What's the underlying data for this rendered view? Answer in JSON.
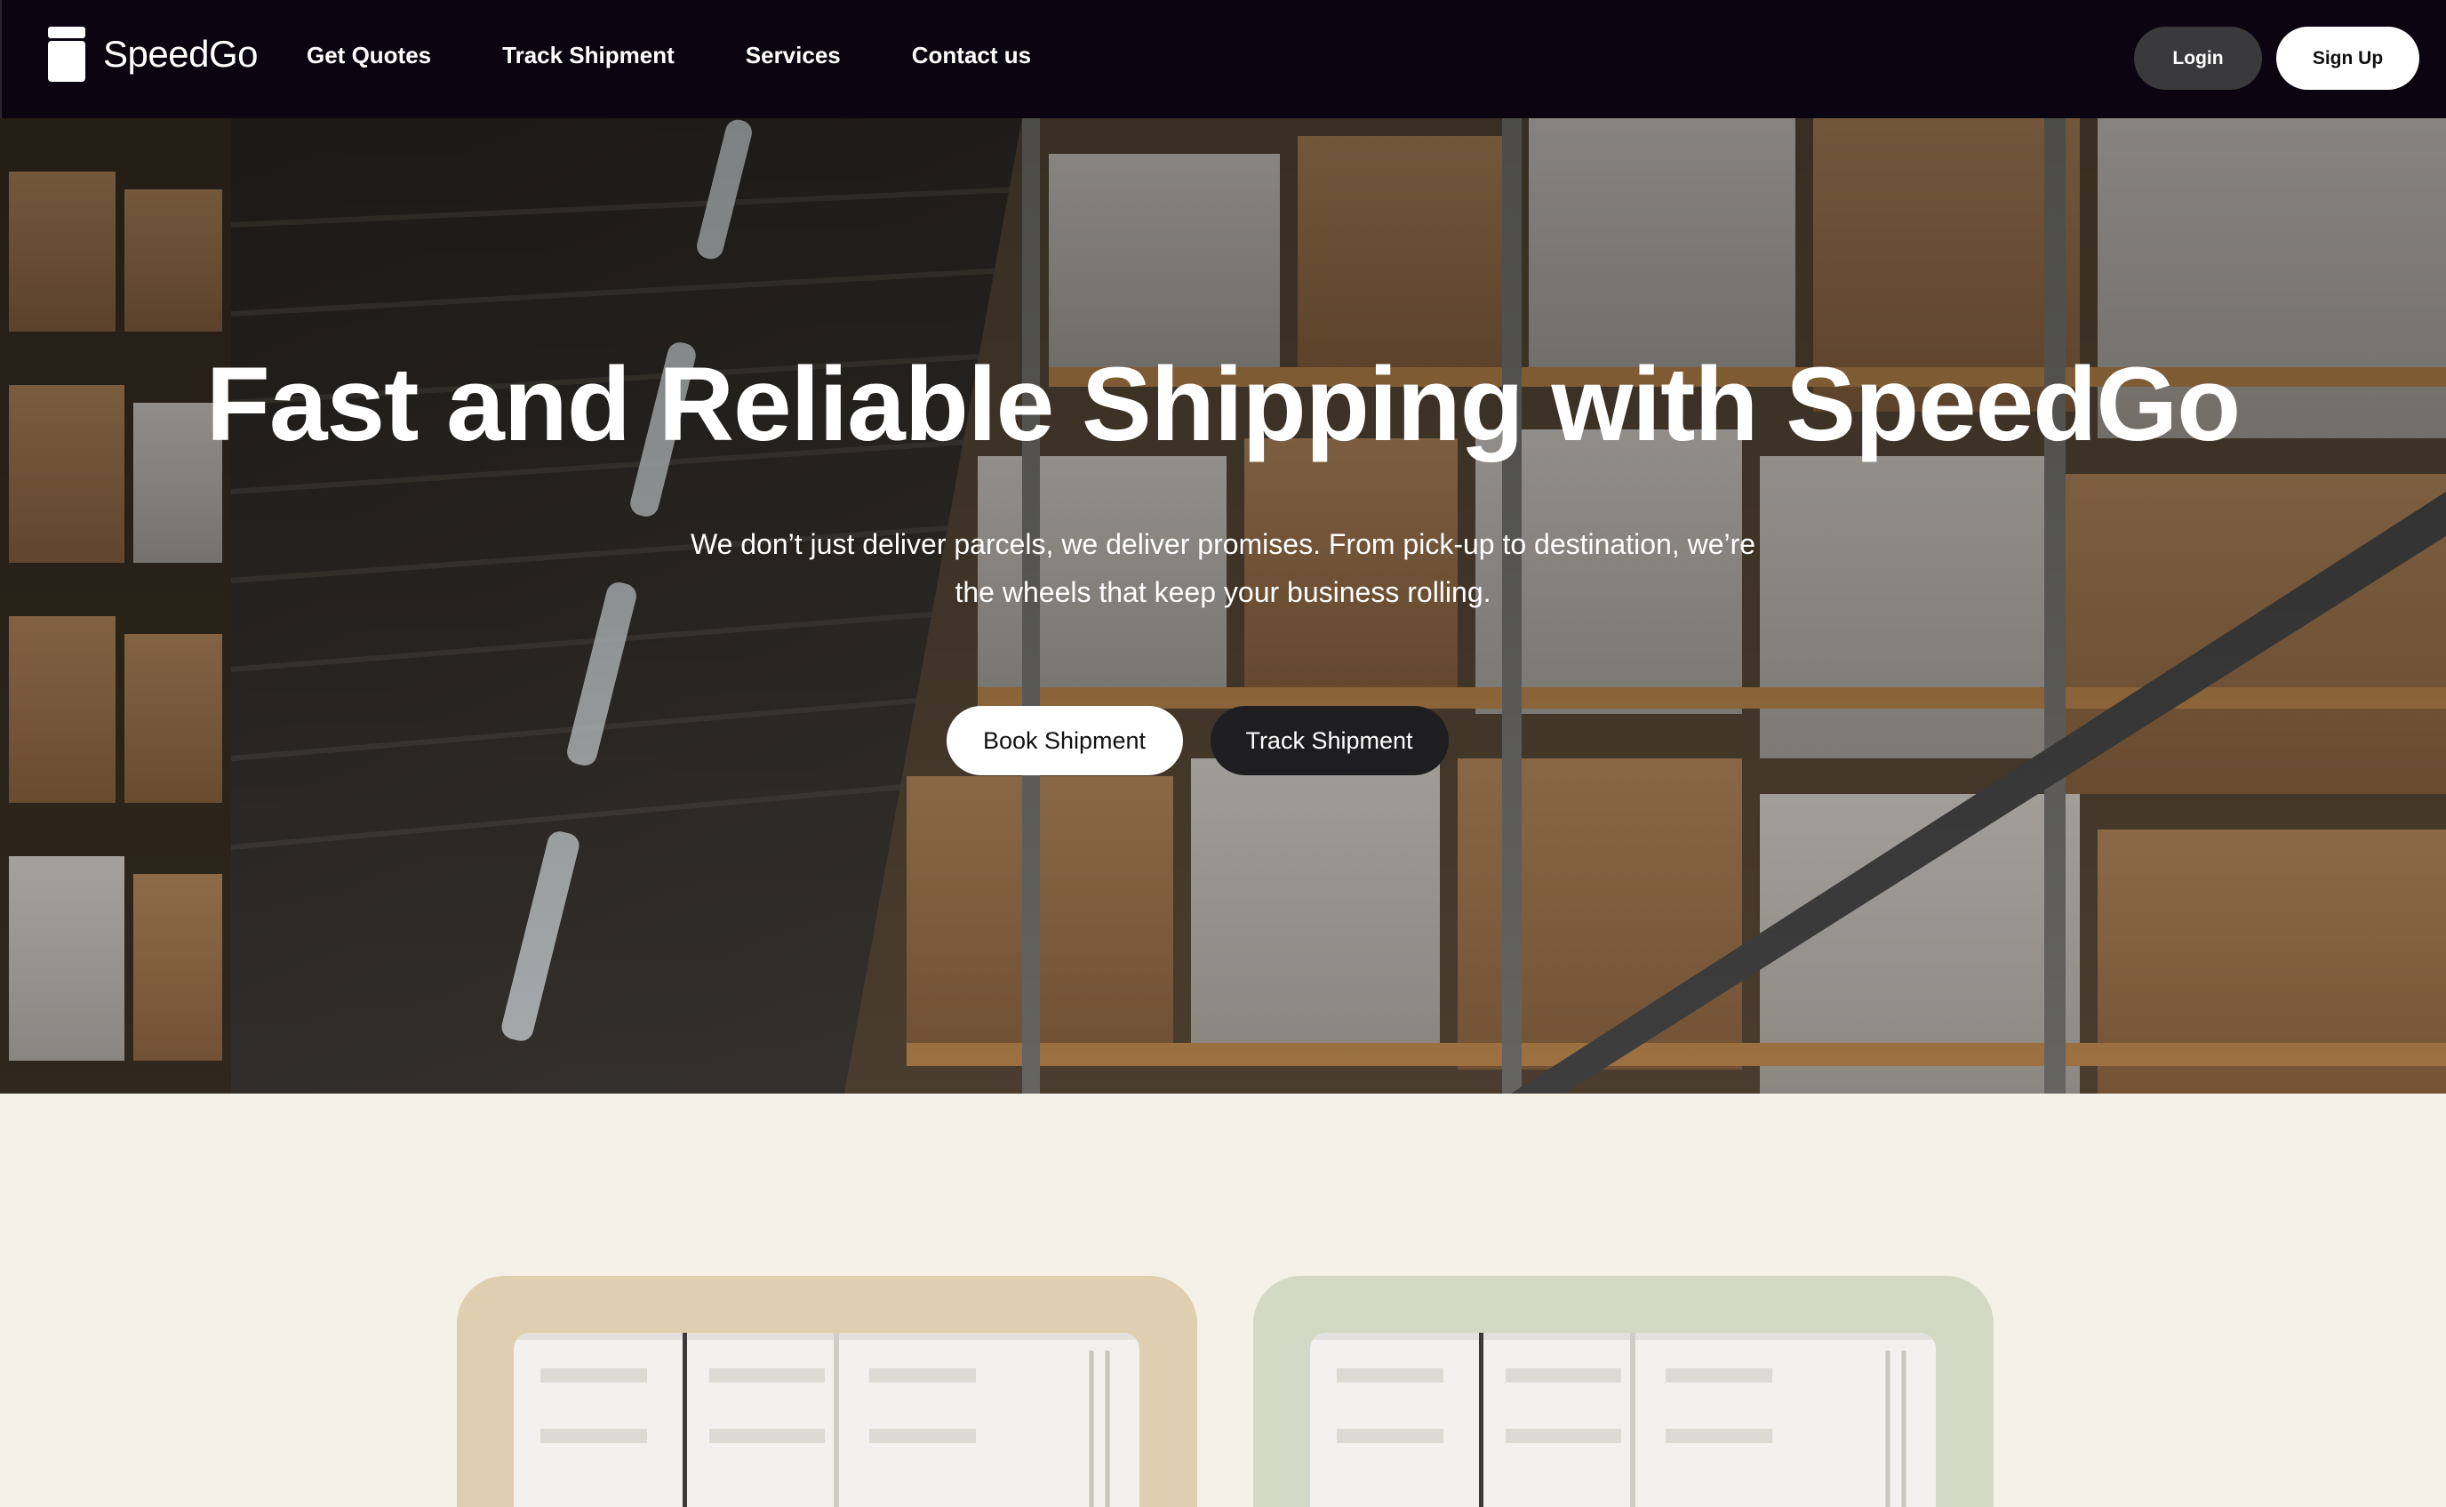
{
  "brand": {
    "name": "SpeedGo",
    "logo_icon": "container-logo-icon"
  },
  "nav": {
    "links": [
      "Get Quotes",
      "Track Shipment",
      "Services",
      "Contact us"
    ],
    "login_label": "Login",
    "signup_label": "Sign Up"
  },
  "hero": {
    "title": "Fast and Reliable Shipping with SpeedGo",
    "subtitle": "We don’t just deliver parcels, we deliver promises. From pick-up to destination, we’re the wheels that keep your business rolling.",
    "background_image": "warehouse-shelves-image",
    "primary_button": "Book Shipment",
    "secondary_button": "Track Shipment"
  },
  "cards": [
    {
      "image": "shipping-container-image",
      "background_color": "#dfcfb0"
    },
    {
      "image": "shipping-container-image",
      "background_color": "#d3d9c4"
    }
  ],
  "colors": {
    "navbar_bg": "#0a0510",
    "page_bg": "#f4f1e8",
    "login_bg": "#3a3a3c",
    "track_button_bg": "#1e1e20"
  }
}
